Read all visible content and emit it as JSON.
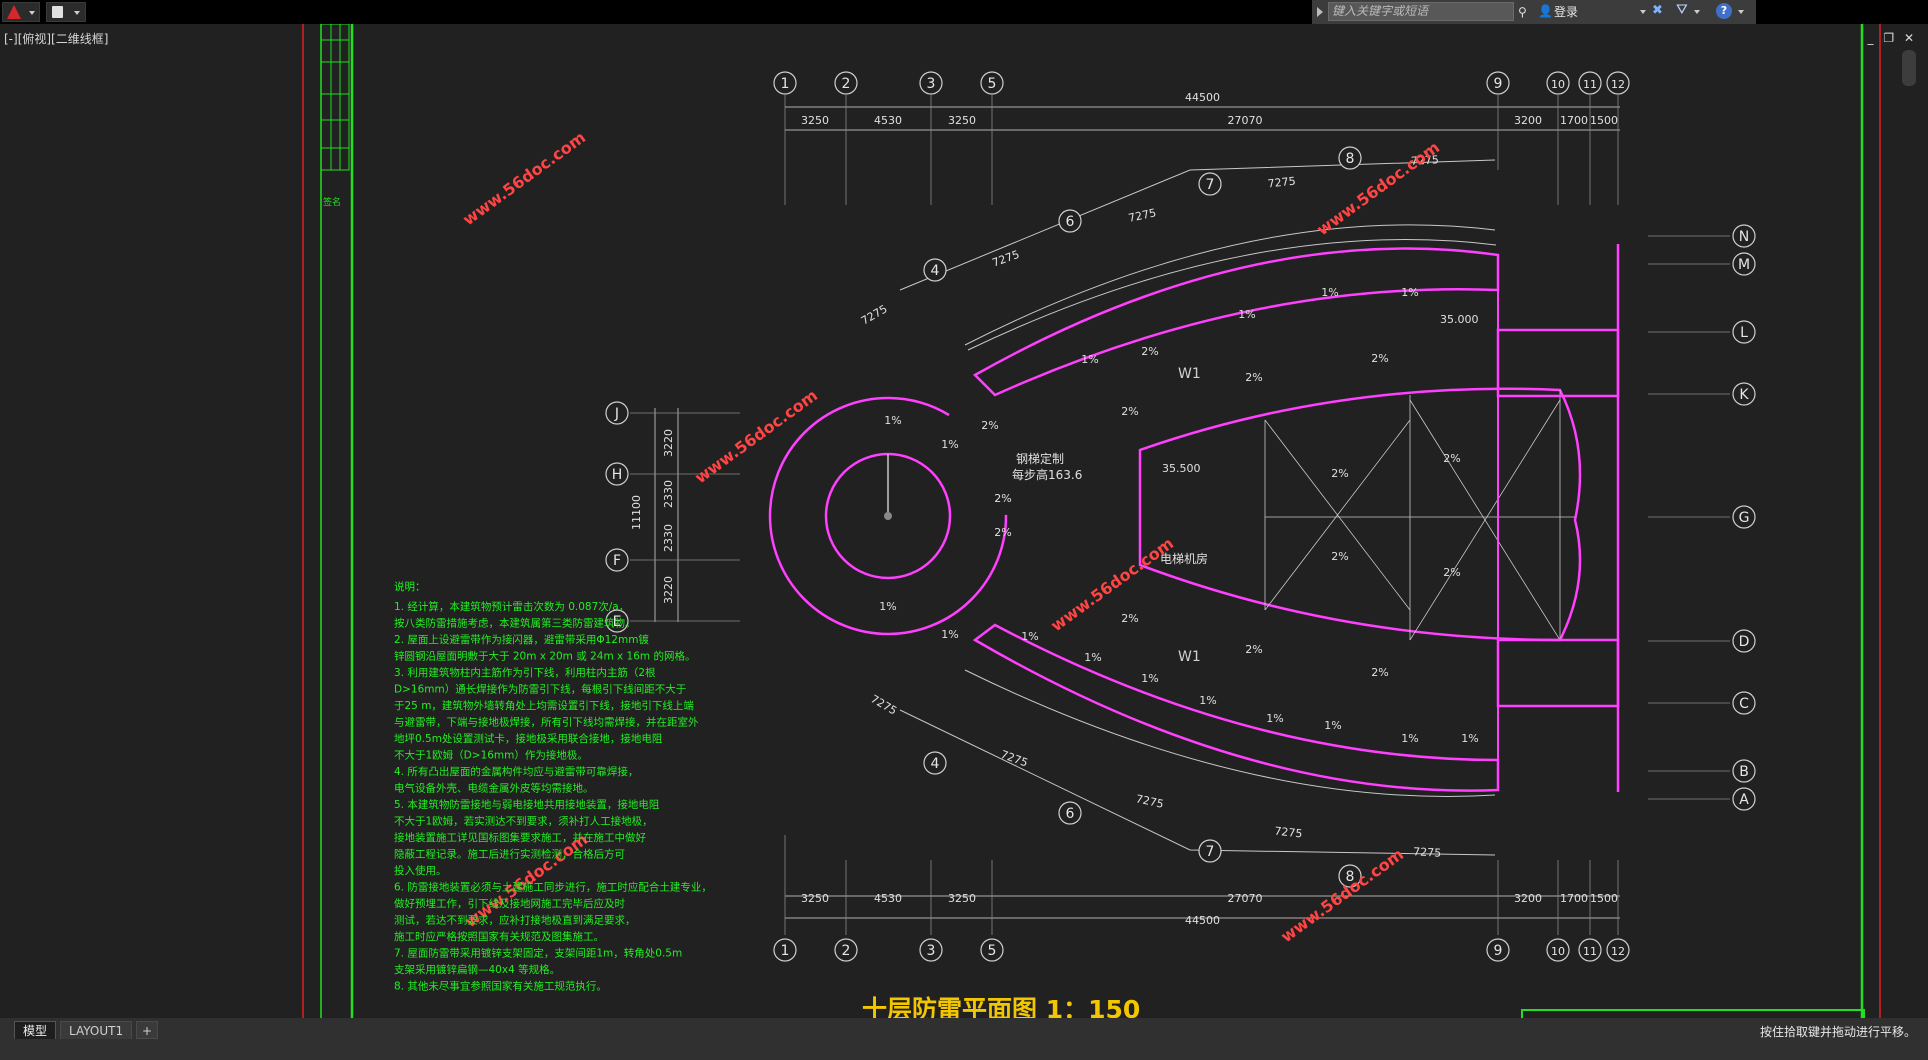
{
  "app": {
    "search_placeholder": "键入关键字或短语",
    "login_label": "登录",
    "viewport_label": "[-][俯视][二维线框]",
    "window_controls": [
      "_",
      "❐",
      "✕"
    ]
  },
  "tabs": {
    "model": "模型",
    "layout1": "LAYOUT1",
    "add": "+"
  },
  "status": {
    "message": "按住拾取键并拖动进行平移。"
  },
  "drawing": {
    "title": "十层防雷平面图 1：150",
    "axes_top": [
      "1",
      "2",
      "3",
      "5",
      "9",
      "10",
      "11",
      "12"
    ],
    "axes_left": [
      "J",
      "H",
      "F",
      "E"
    ],
    "axes_right": [
      "N",
      "M",
      "L",
      "K",
      "G",
      "D",
      "C",
      "B",
      "A"
    ],
    "radial_axes": [
      "4",
      "6",
      "7",
      "8"
    ],
    "dims_top": [
      "3250",
      "4530",
      "3250",
      "27070",
      "3200",
      "1700",
      "1500"
    ],
    "dims_bottom": [
      "3250",
      "4530",
      "3250",
      "27070",
      "3200",
      "1700",
      "1500"
    ],
    "total_dim": "44500",
    "arc_dims": [
      "7275",
      "7275",
      "7275",
      "7275",
      "7275"
    ],
    "left_dims": [
      "3220",
      "2330",
      "2330",
      "3220"
    ],
    "left_total": "11100",
    "slopes": [
      "1%",
      "2%"
    ],
    "roof_label": "W1",
    "elev1": "35.000",
    "elev2": "35.500",
    "elev3": "35.500",
    "text_gangti": "钢梯定制",
    "text_buchang": "每步高163.6",
    "text_dianti": "电梯机房",
    "watermark": "www.56doc.com",
    "notes_heading": "说明：",
    "notes": [
      "1. 经计算，本建筑物预计雷击次数为 0.087次/a，",
      "   按八类防雷措施考虑，本建筑属第三类防雷建筑物。",
      "2. 屋面上设避雷带作为接闪器，避雷带采用Φ12mm镀",
      "   锌圆钢沿屋面明敷于大于 20m x 20m 或 24m x 16m 的网格。",
      "3. 利用建筑物柱内主筋作为引下线，利用柱内主筋（2根",
      "   D>16mm）通长焊接作为防雷引下线，每根引下线间距不大于",
      "   于25 m，建筑物外墙转角处上均需设置引下线，接地引下线上端",
      "   与避雷带，下端与接地极焊接，所有引下线均需焊接，并在距室外",
      "   地坪0.5m处设置测试卡，接地极采用联合接地，接地电阻",
      "   不大于1欧姆（D>16mm）作为接地极。",
      "4. 所有凸出屋面的金属构件均应与避雷带可靠焊接，",
      "   电气设备外壳、电缆金属外皮等均需接地。",
      "5. 本建筑物防雷接地与弱电接地共用接地装置，接地电阻",
      "   不大于1欧姆，若实测达不到要求，须补打人工接地极，",
      "   接地装置施工详见国标图集要求施工，并在施工中做好",
      "   隐蔽工程记录。施工后进行实测检测，合格后方可",
      "   投入使用。",
      "6. 防雷接地装置必须与土建施工同步进行，施工时应配合土建专业，",
      "   做好预埋工作，引下线及接地网施工完毕后应及时",
      "   测试，若达不到要求，应补打接地极直到满足要求，",
      "   施工时应严格按照国家有关规范及图集施工。",
      "7. 屋面防雷带采用镀锌支架固定，支架间距1m，转角处0.5m",
      "   支架采用镀锌扁钢—40x4 等规格。",
      "8. 其他未尽事宜参照国家有关施工规范执行。"
    ]
  }
}
